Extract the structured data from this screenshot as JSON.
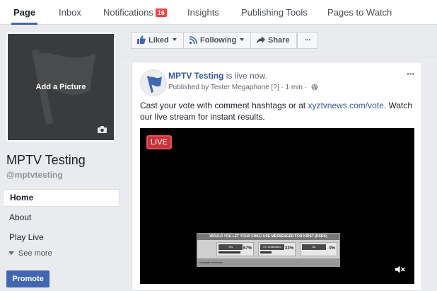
{
  "tabs": [
    {
      "label": "Page",
      "active": true
    },
    {
      "label": "Inbox"
    },
    {
      "label": "Notifications",
      "badge": "16"
    },
    {
      "label": "Insights"
    },
    {
      "label": "Publishing Tools"
    },
    {
      "label": "Pages to Watch"
    }
  ],
  "sidebar": {
    "add_picture": "Add a Picture",
    "page_name": "MPTV Testing",
    "page_handle": "@mptvtesting",
    "nav": [
      {
        "label": "Home",
        "active": true
      },
      {
        "label": "About"
      },
      {
        "label": "Play Live"
      }
    ],
    "see_more": "See more",
    "promote": "Promote"
  },
  "actions": {
    "liked": "Liked",
    "following": "Following",
    "share": "Share",
    "more": "···"
  },
  "post": {
    "author": "MPTV Testing",
    "status": "is live now.",
    "meta": "Published by Tester Megaphone [?] · 1 min ·",
    "options": "···",
    "text_before": "Cast your vote with comment hashtags or at ",
    "link": "xyztvnews.com/vote",
    "text_after": ". Watch our live stream for instant results.",
    "live_badge": "LIVE",
    "mute": "◀×",
    "poll": {
      "question": "WOULD YOU LET YOUR CHILD USE MESSENGER FOR KIDS? (KSDK)",
      "options": [
        {
          "name": "Yes",
          "percent": "67%",
          "value": 0.67
        },
        {
          "name": "I'm Undecided",
          "percent": "33%",
          "value": 0.33
        },
        {
          "name": "No",
          "percent": "0%",
          "value": 0
        }
      ],
      "footer": "example.com/vote"
    }
  },
  "colors": {
    "accent": "#4267b2",
    "link": "#365899",
    "badge": "#fa3e3e",
    "live": "#c8333a"
  }
}
